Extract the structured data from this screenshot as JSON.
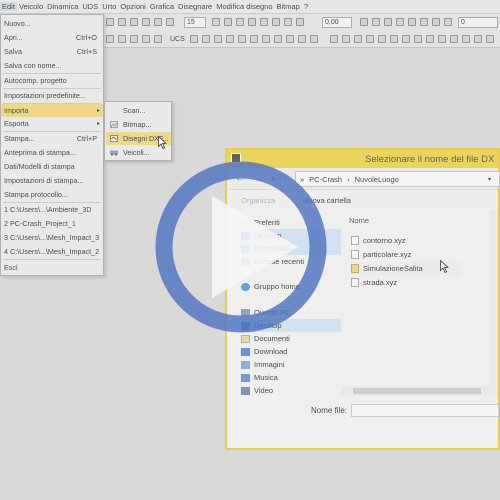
{
  "menubar": {
    "items": [
      "Edit",
      "Veicolo",
      "Dinamica",
      "UDS",
      "Urto",
      "Opzioni",
      "Grafica",
      "Disegnare",
      "Modifica disegno",
      "Bitmap",
      "?"
    ],
    "active_index": 0
  },
  "toolbar": {
    "size_value": "15",
    "ucs_label": "UCS",
    "coord_value": "0,00",
    "layer_value": "0"
  },
  "file_menu": {
    "items": [
      {
        "label": "Nuovo...",
        "shortcut": ""
      },
      {
        "label": "Apri...",
        "shortcut": "Ctrl+O"
      },
      {
        "label": "Salva",
        "shortcut": "Ctrl+S"
      },
      {
        "label": "Salva con nome...",
        "shortcut": ""
      },
      {
        "label": "Autocomp. progetto",
        "shortcut": ""
      },
      {
        "label": "Impostazioni predefinite...",
        "shortcut": ""
      },
      {
        "label": "Importa",
        "shortcut": "",
        "submenu": true,
        "highlighted": true
      },
      {
        "label": "Esporta",
        "shortcut": "",
        "submenu": true
      },
      {
        "label": "Stampa...",
        "shortcut": "Ctrl+P"
      },
      {
        "label": "Anteprima di stampa...",
        "shortcut": ""
      },
      {
        "label": "Dati/Modelli di stampa",
        "shortcut": ""
      },
      {
        "label": "Impostazioni di stampa...",
        "shortcut": ""
      },
      {
        "label": "Stampa protocollo...",
        "shortcut": ""
      },
      {
        "label": "1 C:\\Users\\...\\Ambiente_3D",
        "shortcut": ""
      },
      {
        "label": "2 PC-Crash_Project_1",
        "shortcut": ""
      },
      {
        "label": "3 C:\\Users\\...\\Mesh_Impact_3",
        "shortcut": ""
      },
      {
        "label": "4 C:\\Users\\...\\Mesh_Impact_2",
        "shortcut": ""
      },
      {
        "label": "Esci",
        "shortcut": ""
      }
    ]
  },
  "import_submenu": {
    "items": [
      {
        "label": "Scan...",
        "icon": "scan-icon",
        "highlighted": false
      },
      {
        "label": "Bitmap...",
        "icon": "bitmap-icon",
        "highlighted": false
      },
      {
        "label": "Disegni DXF...",
        "icon": "dxf-icon",
        "highlighted": true
      },
      {
        "label": "Veicoli...",
        "icon": "vehicle-icon",
        "highlighted": false
      }
    ]
  },
  "dialog": {
    "title": "Selezionare il nome del file DX",
    "path": [
      "PC-Crash",
      "NuvoleLuogo"
    ],
    "organize_label": "Organizza",
    "new_folder_label": "Nuova cartella",
    "column_name": "Nome",
    "nav_items": [
      {
        "label": "Preferiti",
        "icon": "star-icon",
        "selected": false
      },
      {
        "label": "Desktop",
        "icon": "desktop-icon",
        "selected": true
      },
      {
        "label": "Download",
        "icon": "download-icon",
        "selected": true
      },
      {
        "label": "Risorse recenti",
        "icon": "recent-icon",
        "selected": false
      },
      {
        "label": "Gruppo home",
        "icon": "homegroup-icon",
        "selected": false
      },
      {
        "label": "Questo PC",
        "icon": "pc-icon",
        "selected": false
      },
      {
        "label": "Desktop",
        "icon": "desktop-icon",
        "selected": true
      },
      {
        "label": "Documenti",
        "icon": "documents-icon",
        "selected": false
      },
      {
        "label": "Download",
        "icon": "download-icon",
        "selected": false
      },
      {
        "label": "Immagini",
        "icon": "pictures-icon",
        "selected": false
      },
      {
        "label": "Musica",
        "icon": "music-icon",
        "selected": false
      },
      {
        "label": "Video",
        "icon": "video-icon",
        "selected": false
      }
    ],
    "files": [
      {
        "name": "contorno.xyz",
        "type": "file",
        "selected": false
      },
      {
        "name": "particolare.xyz",
        "type": "file",
        "selected": false
      },
      {
        "name": "SimulazioneSalita",
        "type": "folder",
        "selected": true
      },
      {
        "name": "strada.xyz",
        "type": "file",
        "selected": false
      }
    ],
    "filename_label": "Nome file:",
    "filename_value": ""
  },
  "overlay": {
    "play_icon": "play-icon",
    "ring_color": "#4f74bf",
    "triangle_color": "#f5f5f5"
  },
  "colors": {
    "menu_highlight": "#f5d76a",
    "dialog_title_bar": "#f2d22a",
    "dialog_border": "#e8c81a"
  }
}
